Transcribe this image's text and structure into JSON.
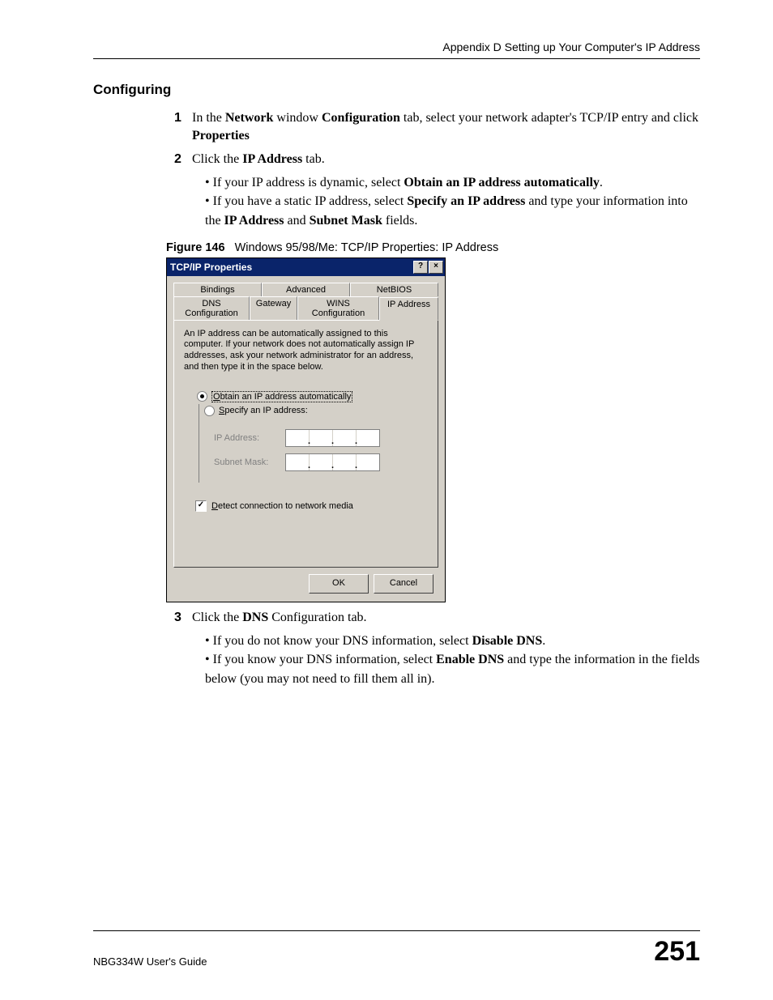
{
  "header": "Appendix D Setting up Your Computer's IP Address",
  "section_heading": "Configuring",
  "steps": {
    "s1": {
      "num": "1",
      "prefix": "In the ",
      "b1": "Network",
      "mid1": " window ",
      "b2": "Configuration",
      "mid2": " tab, select your network adapter's TCP/IP entry and click ",
      "b3": "Properties"
    },
    "s2": {
      "num": "2",
      "prefix": "Click the ",
      "b1": "IP Address",
      "suffix": " tab."
    },
    "s2b1": {
      "prefix": "If your IP address is dynamic, select ",
      "b1": "Obtain an IP address automatically",
      "suffix": "."
    },
    "s2b2": {
      "prefix": "If you have a static IP address, select ",
      "b1": "Specify an IP address",
      "mid": " and type your information into the ",
      "b2": "IP Address",
      "mid2": " and ",
      "b3": "Subnet Mask",
      "suffix": " fields."
    },
    "s3": {
      "num": "3",
      "prefix": "Click the ",
      "b1": "DNS",
      "suffix": " Configuration tab."
    },
    "s3b1": {
      "prefix": "If you do not know your DNS information, select ",
      "b1": "Disable DNS",
      "suffix": "."
    },
    "s3b2": {
      "prefix": "If you know your DNS information, select ",
      "b1": "Enable DNS",
      "suffix": " and type the information in the fields below (you may not need to fill them all in)."
    }
  },
  "figure": {
    "label": "Figure 146",
    "caption": "Windows 95/98/Me: TCP/IP Properties: IP Address"
  },
  "dialog": {
    "title": "TCP/IP Properties",
    "help_btn": "?",
    "close_btn": "×",
    "tabs_row1": [
      "Bindings",
      "Advanced",
      "NetBIOS"
    ],
    "tabs_row2": [
      "DNS Configuration",
      "Gateway",
      "WINS Configuration",
      "IP Address"
    ],
    "infotext": "An IP address can be automatically assigned to this computer. If your network does not automatically assign IP addresses, ask your network administrator for an address, and then type it in the space below.",
    "radio_obtain": {
      "u": "O",
      "rest": "btain an IP address automatically"
    },
    "radio_specify": {
      "u": "S",
      "rest": "pecify an IP address:"
    },
    "label_ip": "IP Address:",
    "label_subnet": "Subnet Mask:",
    "checkbox_detect": {
      "u": "D",
      "rest": "etect connection to network media"
    },
    "checkbox_mark": "✓",
    "ok": "OK",
    "cancel": "Cancel"
  },
  "footer": {
    "left": "NBG334W User's Guide",
    "page": "251"
  }
}
